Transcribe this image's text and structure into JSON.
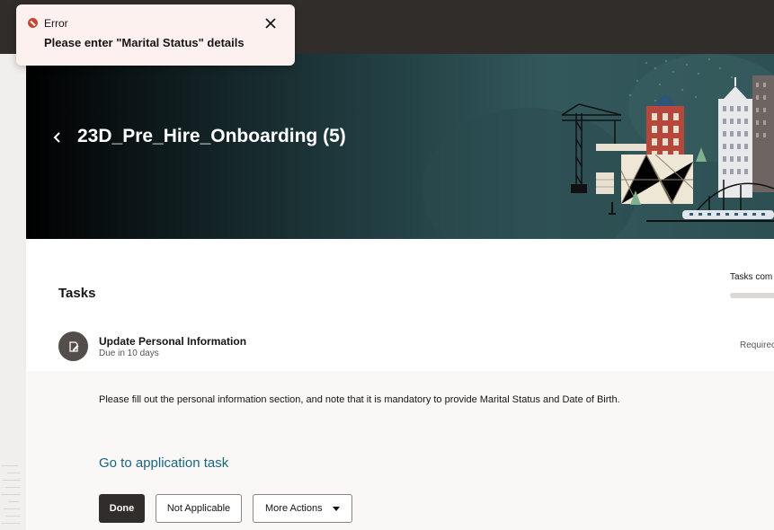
{
  "header": {
    "title": "23D_Pre_Hire_Onboarding (5)"
  },
  "tasks": {
    "heading": "Tasks",
    "completed_label": "Tasks com",
    "items": [
      {
        "name": "Update Personal Information",
        "due": "Due in 10 days",
        "status": "Requirec",
        "description": "Please fill out the personal information section, and note that it is mandatory to provide Marital Status and Date of Birth.",
        "link_label": "Go to application task",
        "actions": {
          "done_label": "Done",
          "not_applicable_label": "Not Applicable",
          "more_actions_label": "More Actions"
        }
      }
    ]
  },
  "toast": {
    "title": "Error",
    "message": "Please enter \"Marital Status\" details"
  },
  "colors": {
    "topbar": "#312d2a",
    "error": "#c74634",
    "link": "#1a6480",
    "primary_button": "#312d2a"
  }
}
